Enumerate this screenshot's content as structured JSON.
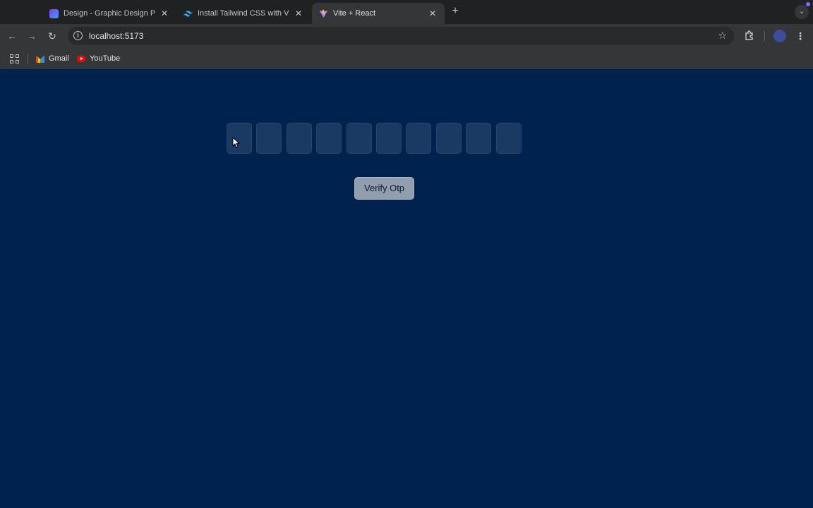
{
  "browser": {
    "tabs": [
      {
        "title": "Design - Graphic Design Portfolio",
        "favicon": "design-app-icon",
        "active": false
      },
      {
        "title": "Install Tailwind CSS with Vite",
        "favicon": "tailwind-icon",
        "active": false
      },
      {
        "title": "Vite + React",
        "favicon": "vite-icon",
        "active": true
      }
    ],
    "new_tab_label": "+",
    "address": "localhost:5173",
    "bookmarks": [
      {
        "label": "Gmail",
        "icon": "gmail-icon"
      },
      {
        "label": "YouTube",
        "icon": "youtube-icon"
      }
    ]
  },
  "page": {
    "otp": {
      "length": 10,
      "values": [
        "",
        "",
        "",
        "",
        "",
        "",
        "",
        "",
        "",
        ""
      ]
    },
    "verify_label": "Verify Otp",
    "colors": {
      "background": "#00224d",
      "otp_box": "#1b3a63",
      "button": "#8f9fb0"
    }
  }
}
